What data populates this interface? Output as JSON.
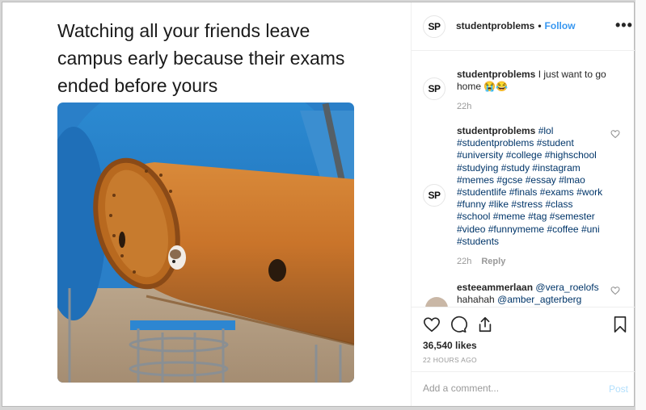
{
  "meme": {
    "caption": "Watching all your friends leave campus early because their exams ended before yours"
  },
  "header": {
    "avatar_text": "SP",
    "username": "studentproblems",
    "dot": "•",
    "follow_label": "Follow",
    "more_icon": "more-horizontal-icon"
  },
  "comments": [
    {
      "avatar_text": "SP",
      "username": "studentproblems",
      "text": "I just want to go home 😭😂",
      "time": "22h"
    },
    {
      "avatar_text": "SP",
      "username": "studentproblems",
      "hashtags": [
        "#lol",
        "#studentproblems",
        "#student",
        "#university",
        "#college",
        "#highschool",
        "#studying",
        "#study",
        "#instagram",
        "#memes",
        "#gcse",
        "#essay",
        "#lmao",
        "#studentlife",
        "#finals",
        "#exams",
        "#work",
        "#funny",
        "#like",
        "#stress",
        "#class",
        "#school",
        "#meme",
        "#tag",
        "#semester",
        "#video",
        "#funnymeme",
        "#coffee",
        "#uni",
        "#students"
      ],
      "time": "22h",
      "reply_label": "Reply"
    },
    {
      "username": "esteeammerlaan",
      "mention1": "@vera_roelofs",
      "text": "hahahah",
      "mention2": "@amber_agterberg"
    }
  ],
  "actions": {
    "likes": "36,540 likes",
    "time": "22 HOURS AGO"
  },
  "add_comment": {
    "placeholder": "Add a comment...",
    "post_label": "Post"
  },
  "colors": {
    "link": "#3897f0",
    "hashtag": "#003569",
    "post_disabled": "#b2dffc"
  }
}
